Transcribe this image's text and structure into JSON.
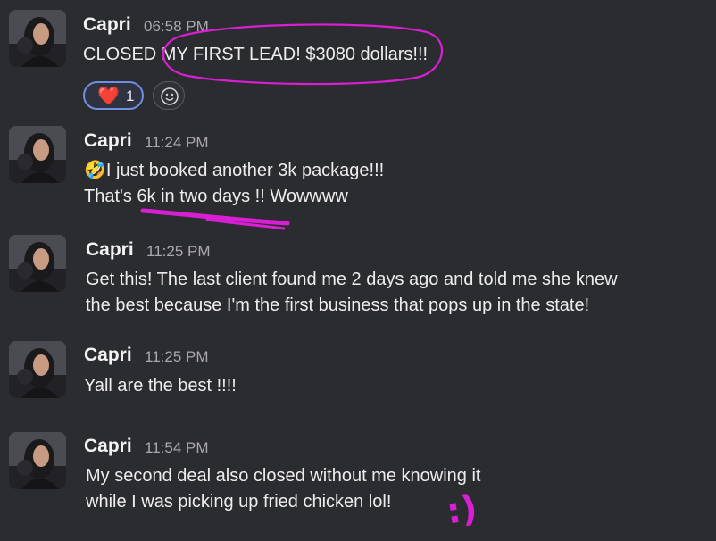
{
  "colors": {
    "background": "#2b2c30",
    "annotation": "#d81fd4",
    "reaction_border": "#6f8fe0",
    "heart": "#e0283b"
  },
  "messages": [
    {
      "name": "Capri",
      "time": "06:58 PM",
      "lines": [
        "CLOSED MY FIRST LEAD! $3080 dollars!!!"
      ],
      "reactions": [
        {
          "emoji": "❤️",
          "count": "1"
        }
      ],
      "add_reaction_icon": "smiley-add-icon"
    },
    {
      "name": "Capri",
      "time": "11:24 PM",
      "emoji": "🤣",
      "lines": [
        "I just booked another 3k package!!!",
        "That's 6k in two days !! Wowwww"
      ]
    },
    {
      "name": "Capri",
      "time": "11:25 PM",
      "lines": [
        "Get this! The last client found me 2 days ago and told me she knew",
        "the best because I'm the first business that pops up in the state!"
      ]
    },
    {
      "name": "Capri",
      "time": "11:25 PM",
      "lines": [
        "Yall are the best !!!!"
      ]
    },
    {
      "name": "Capri",
      "time": "11:54 PM",
      "lines": [
        "My second deal also closed without me knowing it",
        "while I was picking up fried chicken lol!"
      ],
      "annotation": ":)"
    }
  ]
}
